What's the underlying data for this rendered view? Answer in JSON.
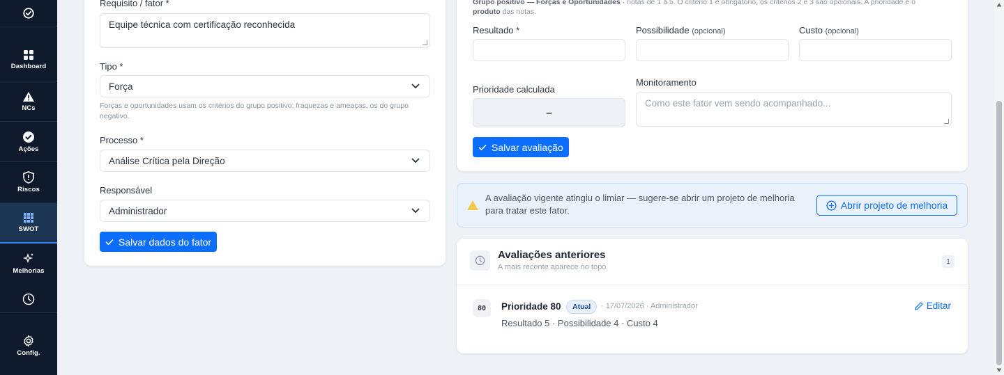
{
  "sidebar": {
    "items": [
      {
        "label": "Dashboard",
        "icon": "grid-icon"
      },
      {
        "label": "NCs",
        "icon": "warning-icon"
      },
      {
        "label": "Ações",
        "icon": "check-circle-icon"
      },
      {
        "label": "Riscos",
        "icon": "shield-alert-icon"
      },
      {
        "label": "SWOT",
        "icon": "swot-grid-icon"
      },
      {
        "label": "Melhorias",
        "icon": "sparkles-icon"
      },
      {
        "label": "",
        "icon": "clock-icon"
      },
      {
        "label": "Config.",
        "icon": "gear-icon"
      }
    ],
    "active": "SWOT"
  },
  "factor_form": {
    "requisito_label": "Requisito / fator *",
    "requisito_value": "Equipe técnica com certificação reconhecida",
    "tipo_label": "Tipo *",
    "tipo_value": "Força",
    "tipo_help": "Forças e oportunidades usam os critérios do grupo positivo; fraquezas e ameaças, os do grupo negativo.",
    "processo_label": "Processo *",
    "processo_value": "Análise Crítica pela Direção",
    "responsavel_label": "Responsável",
    "responsavel_value": "Administrador",
    "save_label": "Salvar dados do fator"
  },
  "evaluation": {
    "top_note_bold1": "Grupo positivo — Forças e Oportunidades",
    "top_note_rest": " · notas de 1 a 5. O critério 1 é obrigatório, os critérios 2 e 3 são opcionais. A prioridade é o",
    "top_note_bold2": "produto",
    "top_note_end": " das notas.",
    "resultado_label": "Resultado *",
    "possibilidade_label": "Possibilidade",
    "possibilidade_opt": "(opcional)",
    "custo_label": "Custo",
    "custo_opt": "(opcional)",
    "prioridade_label": "Prioridade calculada",
    "prioridade_value": "–",
    "monitoramento_label": "Monitoramento",
    "monitoramento_placeholder": "Como este fator vem sendo acompanhado...",
    "save_label": "Salvar avaliação"
  },
  "alert": {
    "text": "A avaliação vigente atingiu o limiar — sugere-se abrir um projeto de melhoria para tratar este fator.",
    "button_label": "Abrir projeto de melhoria",
    "icon_color": "#f2c94c"
  },
  "history": {
    "title": "Avaliações anteriores",
    "subtitle": "A mais recente aparece no topo",
    "count": "1",
    "entries": [
      {
        "score": "80",
        "title": "Prioridade 80",
        "badge": "Atual",
        "meta": "· 17/07/2026 · Administrador",
        "details": "Resultado 5 · Possibilidade 4 · Custo 4",
        "edit_label": "Editar"
      }
    ]
  },
  "colors": {
    "sidebar_bg": "#0e1a2b",
    "primary": "#0d6efd",
    "page_bg": "#eef1f6"
  }
}
